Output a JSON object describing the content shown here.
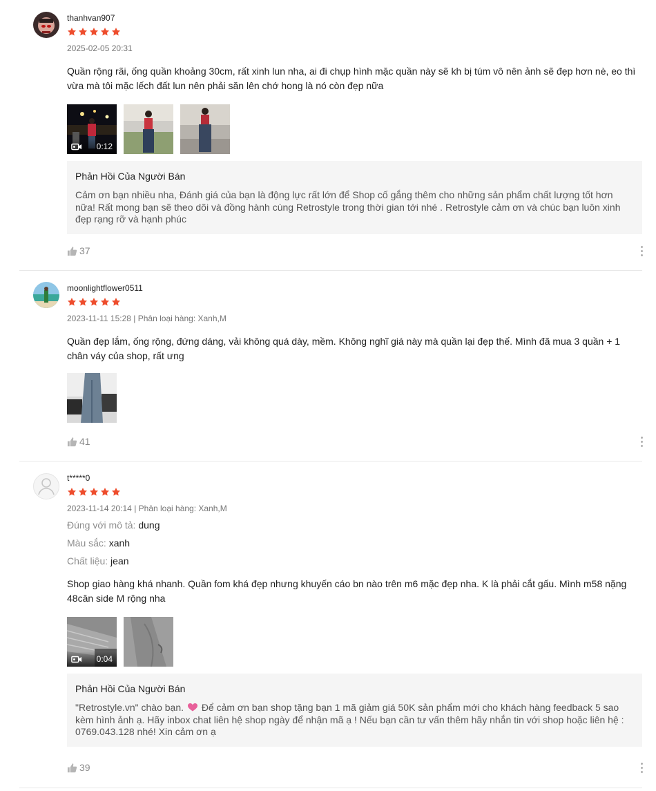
{
  "colors": {
    "star": "#ee4d2d",
    "reply_bg": "#f5f5f5",
    "muted": "#757575"
  },
  "reviews": [
    {
      "username": "thanhvan907",
      "rating": 5,
      "meta": "2025-02-05 20:31",
      "content": "Quần rộng rãi, ống quần khoảng 30cm, rất xinh lun nha, ai đi chụp hình mặc quần này sẽ kh bị túm vô nên ảnh sẽ đẹp hơn nè, eo thì vừa mà tôi mặc lếch đất lun nên phải săn lên chớ hong là nó còn đẹp nữa",
      "video_duration": "0:12",
      "reply_title": "Phản Hồi Của Người Bán",
      "reply_text": "Cảm ơn bạn nhiều nha, Đánh giá của bạn là động lực rất lớn để Shop cố gắng thêm cho những sản phẩm chất lượng tốt hơn nữa! Rất mong bạn sẽ theo dõi và đồng hành cùng Retrostyle trong thời gian tới nhé . Retrostyle cảm ơn và chúc bạn luôn xinh đẹp rạng rỡ và hạnh phúc",
      "likes": "37"
    },
    {
      "username": "moonlightflower0511",
      "rating": 5,
      "meta": "2023-11-11 15:28 | Phân loại hàng: Xanh,M",
      "content": "Quần đẹp lắm, ống rộng, đứng dáng, vải không quá dày, mềm. Không nghĩ giá này mà quần lại đẹp thế. Mình đã mua 3 quần + 1 chân váy của shop, rất ưng",
      "likes": "41"
    },
    {
      "username": "t*****0",
      "rating": 5,
      "meta": "2023-11-14 20:14 | Phân loại hàng: Xanh,M",
      "attrs": [
        {
          "k": "Đúng với mô tả:",
          "v": "dung"
        },
        {
          "k": "Màu sắc:",
          "v": "xanh"
        },
        {
          "k": "Chất liệu:",
          "v": "jean"
        }
      ],
      "content": "Shop giao hàng khá nhanh. Quần fom khá đẹp nhưng khuyến cáo bn nào trên m6 mặc đẹp nha. K là phải cắt gấu. Mình m58 nặng 48cân side M rộng nha",
      "video_duration": "0:04",
      "reply_title": "Phản Hồi Của Người Bán",
      "reply_text_before_heart": "\"Retrostyle.vn\" chào bạn.",
      "reply_text_after_heart": "Để cảm ơn bạn shop tặng bạn 1 mã giảm giá 50K sản phẩm mới cho khách hàng feedback 5 sao kèm hình ảnh ạ. Hãy inbox chat liên hệ shop ngày để nhận mã ạ ! Nếu bạn cần tư vấn thêm hãy nhắn tin với shop hoặc liên hệ : 0769.043.128 nhé! Xin cảm ơn ạ",
      "likes": "39"
    }
  ]
}
